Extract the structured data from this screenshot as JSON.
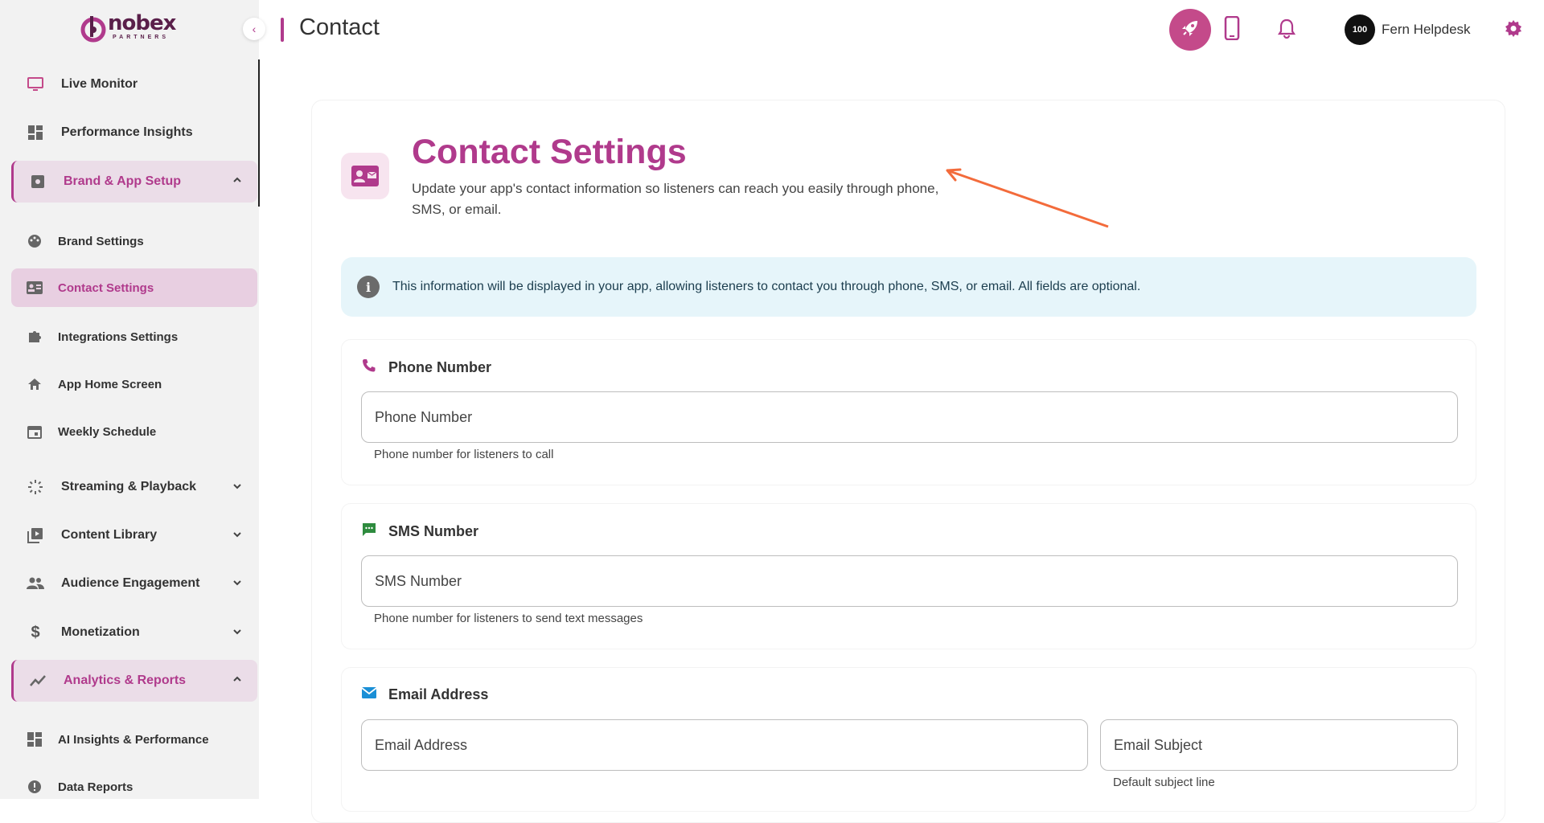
{
  "logo": {
    "name": "nobex",
    "sub": "PARTNERS"
  },
  "sidebar": {
    "items": [
      {
        "label": "Live Monitor",
        "icon": "monitor-icon"
      },
      {
        "label": "Performance Insights",
        "icon": "dashboard-icon"
      },
      {
        "label": "Brand & App Setup",
        "icon": "settings-box-icon"
      },
      {
        "label": "Brand Settings",
        "icon": "palette-icon"
      },
      {
        "label": "Contact Settings",
        "icon": "contact-card-icon"
      },
      {
        "label": "Integrations Settings",
        "icon": "puzzle-icon"
      },
      {
        "label": "App Home Screen",
        "icon": "home-icon"
      },
      {
        "label": "Weekly Schedule",
        "icon": "calendar-icon"
      },
      {
        "label": "Streaming & Playback",
        "icon": "streaming-icon"
      },
      {
        "label": "Content Library",
        "icon": "library-icon"
      },
      {
        "label": "Audience Engagement",
        "icon": "people-icon"
      },
      {
        "label": "Monetization",
        "icon": "dollar-icon"
      },
      {
        "label": "Analytics & Reports",
        "icon": "analytics-icon"
      },
      {
        "label": "AI Insights & Performance",
        "icon": "dashboard-icon"
      },
      {
        "label": "Data Reports",
        "icon": "report-icon"
      }
    ]
  },
  "header": {
    "title": "Contact",
    "user_name": "Fern Helpdesk",
    "avatar_text": "100"
  },
  "main": {
    "title": "Contact Settings",
    "description": "Update your app's contact information so listeners can reach you easily through phone, SMS, or email.",
    "info": "This information will be displayed in your app, allowing listeners to contact you through phone, SMS, or email. All fields are optional.",
    "phone": {
      "heading": "Phone Number",
      "placeholder": "Phone Number",
      "helper": "Phone number for listeners to call"
    },
    "sms": {
      "heading": "SMS Number",
      "placeholder": "SMS Number",
      "helper": "Phone number for listeners to send text messages"
    },
    "email": {
      "heading": "Email Address",
      "placeholder": "Email Address",
      "subject_placeholder": "Email Subject",
      "subject_helper": "Default subject line"
    }
  },
  "colors": {
    "accent": "#b03a8c",
    "info_bg": "#e6f5fa",
    "sms_icon": "#2e8b3e",
    "email_icon": "#1a8fd6"
  }
}
